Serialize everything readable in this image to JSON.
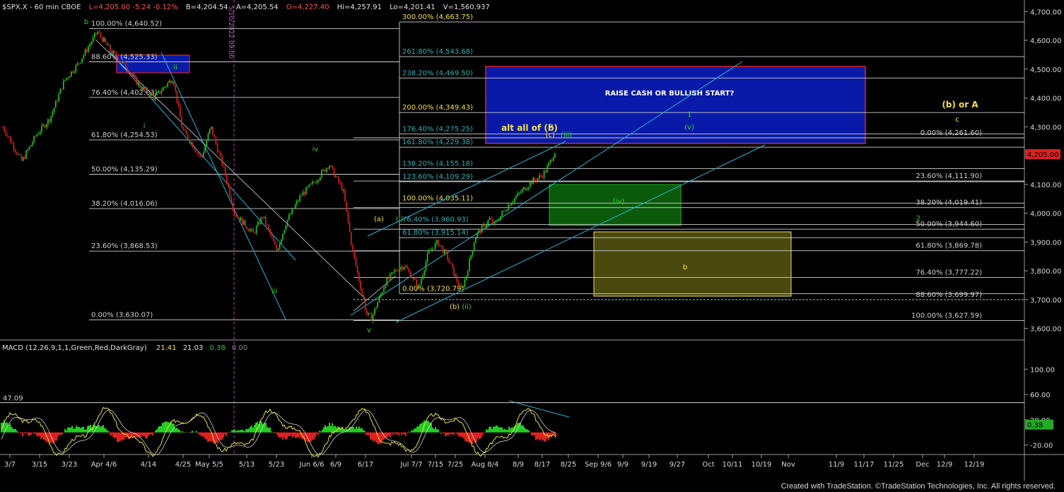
{
  "header": {
    "symbol": "$SPX.X - 60 min  CBOE",
    "last": "L=4,205.00  -5.24  -0.12%",
    "bid": "B=4,204.54",
    "ask": "A=4,205.54",
    "open": "O=4,227.40",
    "high": "Hi=4,257.91",
    "low": "Lo=4,201.41",
    "volume": "V=1,560,937"
  },
  "footer": {
    "credit": "Created with TradeStation. ©TradeStation Technologies, Inc. All rights reserved."
  },
  "colors": {
    "up_candle": "#22cc22",
    "down_candle": "#e02020",
    "fib_line": "#cfcfcf",
    "fib_label": "#cfcfcf",
    "green_label": "#33cc33",
    "yellow_label": "#f0e040",
    "blue_box": "#0a1aa8",
    "blue_box_border": "#e02020",
    "green_box": "#0b5a0b",
    "yellow_box": "#5a5a10",
    "cyan_line": "#1fb8d8",
    "vline": "#b040b0"
  },
  "chart_data": [
    {
      "type": "line",
      "title": "$SPX.X - 60 min",
      "ylim": [
        3560,
        4740
      ],
      "y_ticks": [
        "4,700.00",
        "4,600.00",
        "4,500.00",
        "4,400.00",
        "4,300.00",
        "4,100.00",
        "4,000.00",
        "3,900.00",
        "3,800.00",
        "3,700.00",
        "3,600.00"
      ],
      "y_tick_values": [
        4700,
        4600,
        4500,
        4400,
        4300,
        4100,
        4000,
        3900,
        3800,
        3700,
        3600
      ],
      "last_price_label": "4,205.00",
      "last_price": 4205,
      "x_ticks": [
        "3/7",
        "3/15",
        "3/23",
        "Apr 4/6",
        "4/14",
        "4/25",
        "May 5/5",
        "5/13",
        "5/23",
        "Jun 6/6",
        "6/9",
        "6/17",
        "Jul 7/7",
        "7/15",
        "7/25",
        "Aug 8/4",
        "8/9",
        "8/17",
        "8/25",
        "Sep 9/6",
        "9/9",
        "9/19",
        "9/27",
        "Oct",
        "10/11",
        "10/19",
        "Nov",
        "11/9",
        "11/17",
        "11/25",
        "Dec",
        "12/9",
        "12/19"
      ],
      "price_path": {
        "dates": [
          "3/1",
          "3/7",
          "3/10",
          "3/15",
          "3/18",
          "3/23",
          "3/29",
          "4/1",
          "4/6",
          "4/11",
          "4/14",
          "4/20",
          "4/22",
          "4/28",
          "5/2",
          "5/5",
          "5/9",
          "5/13",
          "5/17",
          "5/20",
          "5/24",
          "5/27",
          "6/1",
          "6/6",
          "6/9",
          "6/13",
          "6/16",
          "6/17",
          "6/22",
          "6/24",
          "6/28",
          "7/1",
          "7/5",
          "7/7",
          "7/11",
          "7/14",
          "7/15",
          "7/19",
          "7/22",
          "7/25",
          "7/28",
          "8/2",
          "8/4",
          "8/8",
          "8/9",
          "8/11",
          "8/12"
        ],
        "values": [
          4300,
          4180,
          4270,
          4330,
          4460,
          4520,
          4630,
          4560,
          4510,
          4440,
          4400,
          4470,
          4290,
          4190,
          4300,
          4140,
          4000,
          3930,
          3990,
          3870,
          3970,
          4060,
          4110,
          4170,
          4080,
          3870,
          3650,
          3636,
          3760,
          3800,
          3820,
          3740,
          3860,
          3900,
          3850,
          3730,
          3780,
          3920,
          3980,
          3960,
          4030,
          4080,
          4110,
          4130,
          4150,
          4220,
          4205
        ]
      },
      "fib_left": [
        {
          "label": "100.00% (4,640.52)",
          "value": 4640.52
        },
        {
          "label": "88.60% (4,525.33)",
          "value": 4525.33
        },
        {
          "label": "76.40% (4,402.03)",
          "value": 4402.03
        },
        {
          "label": "61.80% (4,254.53)",
          "value": 4254.53
        },
        {
          "label": "50.00% (4,135.29)",
          "value": 4135.29
        },
        {
          "label": "38.20% (4,016.06)",
          "value": 4016.06
        },
        {
          "label": "23.60% (3,868.53)",
          "value": 3868.53
        },
        {
          "label": "0.00% (3,630.07)",
          "value": 3630.07
        }
      ],
      "fib_mid": [
        {
          "label": "300.00% (4,663.75)",
          "value": 4663.75,
          "color": "yellow"
        },
        {
          "label": "261.80% (4,543.68)",
          "value": 4543.68,
          "color": "teal"
        },
        {
          "label": "238.20% (4,469.50)",
          "value": 4469.5,
          "color": "teal"
        },
        {
          "label": "200.00% (4,349.43)",
          "value": 4349.43,
          "color": "yellow"
        },
        {
          "label": "176.40% (4,275.25)",
          "value": 4275.25,
          "color": "teal"
        },
        {
          "label": "161.80% (4,229.38)",
          "value": 4229.38,
          "color": "teal"
        },
        {
          "label": "138.20% (4,155.18)",
          "value": 4155.18,
          "color": "teal"
        },
        {
          "label": "123.60% (4,109.29)",
          "value": 4109.29,
          "color": "teal"
        },
        {
          "label": "100.00% (4,035.11)",
          "value": 4035.11,
          "color": "yellow"
        },
        {
          "label": "76.40% (3,960.93)",
          "value": 3960.93,
          "color": "teal"
        },
        {
          "label": "61.80% (3,915.14)",
          "value": 3915.14,
          "color": "teal"
        },
        {
          "label": "0.00% (3,720.79)",
          "value": 3720.79,
          "color": "yellow"
        }
      ],
      "fib_right": [
        {
          "label": "0.00% (4,261.60)",
          "value": 4261.6
        },
        {
          "label": "23.60% (4,111.90)",
          "value": 4111.9
        },
        {
          "label": "38.20% (4,019.41)",
          "value": 4019.41
        },
        {
          "label": "50.00% (3,944.60)",
          "value": 3944.6
        },
        {
          "label": "61.80% (3,869.78)",
          "value": 3869.78
        },
        {
          "label": "76.40% (3,777.22)",
          "value": 3777.22
        },
        {
          "label": "88.60% (3,699.97)",
          "value": 3699.97
        },
        {
          "label": "100.00% (3,627.59)",
          "value": 3627.59
        }
      ],
      "annotations": {
        "box_text": "RAISE CASH OR BULLISH START?",
        "alt": "alt all of (b)",
        "b_or_a": "(b) or A",
        "vline_date": "5/10/2022 09:00",
        "wave_labels": [
          "b",
          "ii",
          "i",
          "iii",
          "iv",
          "v",
          "(a)",
          "(i)",
          "(b)",
          "(ii)",
          "a",
          "(c)",
          "(iii)",
          "1",
          "(v)",
          "(iv)",
          "2",
          "c",
          "b"
        ]
      }
    },
    {
      "type": "line",
      "title": "MACD (12,26,9,1,1,Green,Red,DarkGray)",
      "values_text": [
        "21.41",
        "21.03",
        "0.38",
        "0.00"
      ],
      "ylim": [
        -35,
        125
      ],
      "y_ticks": [
        "100.00",
        "60.00",
        "20.00",
        "-20.00"
      ],
      "y_tick_values": [
        100,
        60,
        20,
        -20
      ],
      "level_label": "47.09",
      "level": 47.09,
      "hist_label": "0.38",
      "hist_value": 0.38
    }
  ]
}
